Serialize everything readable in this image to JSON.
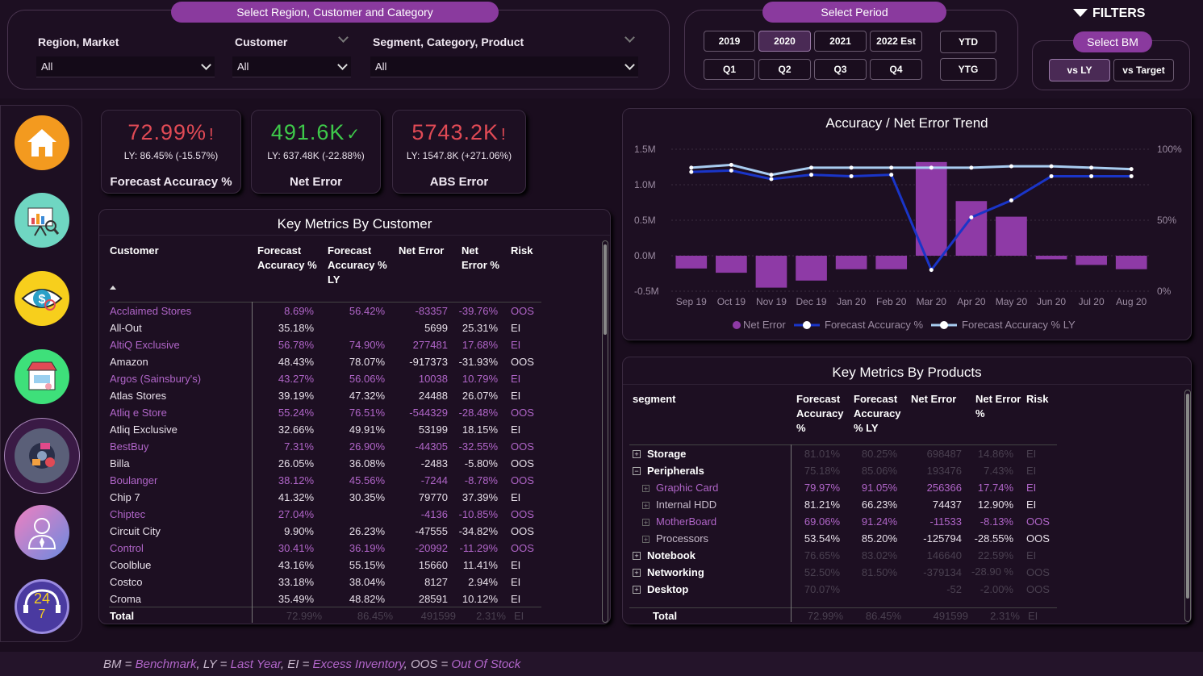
{
  "filters_panel": {
    "title": "Select Region, Customer and Category",
    "region_label": "Region, Market",
    "region_value": "All",
    "customer_label": "Customer",
    "customer_value": "All",
    "segment_label": "Segment, Category, Product",
    "segment_value": "All"
  },
  "period_panel": {
    "title": "Select Period",
    "years": [
      "2019",
      "2020",
      "2021",
      "2022 Est"
    ],
    "quarters": [
      "Q1",
      "Q2",
      "Q3",
      "Q4"
    ],
    "ytd": "YTD",
    "ytg": "YTG",
    "selected_year": "2020"
  },
  "bm_panel": {
    "filters_title": "FILTERS",
    "title": "Select BM",
    "options": [
      "vs LY",
      "vs Target"
    ],
    "selected": "vs LY"
  },
  "sidebar": {
    "items": [
      "home-icon",
      "presentation-chart-icon",
      "eye-dollar-icon",
      "store-icon",
      "forecast-disc-icon",
      "person-icon",
      "support-24-7-icon"
    ],
    "selected_index": 4
  },
  "kpis": [
    {
      "value": "72.99%",
      "flag": "!",
      "ly": "LY: 86.45% (-15.57%)",
      "title": "Forecast Accuracy %",
      "status": "bad"
    },
    {
      "value": "491.6K",
      "flag": "✓",
      "ly": "LY: 637.48K (-22.88%)",
      "title": "Net Error",
      "status": "good"
    },
    {
      "value": "5743.2K",
      "flag": "!",
      "ly": "LY: 1547.8K (+271.06%)",
      "title": "ABS Error",
      "status": "bad"
    }
  ],
  "customer_table": {
    "title": "Key Metrics By Customer",
    "headers": [
      "Customer",
      "Forecast Accuracy %",
      "Forecast Accuracy % LY",
      "Net Error",
      "Net Error %",
      "Risk"
    ],
    "rows": [
      [
        "Acclaimed Stores",
        "8.69%",
        "56.42%",
        "-83357",
        "-39.76%",
        "OOS"
      ],
      [
        "All-Out",
        "35.18%",
        "",
        "5699",
        "25.31%",
        "EI"
      ],
      [
        "AltiQ Exclusive",
        "56.78%",
        "74.90%",
        "277481",
        "17.68%",
        "EI"
      ],
      [
        "Amazon",
        "48.43%",
        "78.07%",
        "-917373",
        "-31.93%",
        "OOS"
      ],
      [
        "Argos (Sainsbury's)",
        "43.27%",
        "56.06%",
        "10038",
        "10.79%",
        "EI"
      ],
      [
        "Atlas Stores",
        "39.19%",
        "47.32%",
        "24488",
        "26.07%",
        "EI"
      ],
      [
        "Atliq e Store",
        "55.24%",
        "76.51%",
        "-544329",
        "-28.48%",
        "OOS"
      ],
      [
        "Atliq Exclusive",
        "32.66%",
        "49.91%",
        "53199",
        "18.15%",
        "EI"
      ],
      [
        "BestBuy",
        "7.31%",
        "26.90%",
        "-44305",
        "-32.55%",
        "OOS"
      ],
      [
        "Billa",
        "26.05%",
        "36.08%",
        "-2483",
        "-5.80%",
        "OOS"
      ],
      [
        "Boulanger",
        "38.12%",
        "45.56%",
        "-7244",
        "-8.78%",
        "OOS"
      ],
      [
        "Chip 7",
        "41.32%",
        "30.35%",
        "79770",
        "37.39%",
        "EI"
      ],
      [
        "Chiptec",
        "27.04%",
        "",
        "-4136",
        "-10.85%",
        "OOS"
      ],
      [
        "Circuit City",
        "9.90%",
        "26.23%",
        "-47555",
        "-34.82%",
        "OOS"
      ],
      [
        "Control",
        "30.41%",
        "36.19%",
        "-20992",
        "-11.29%",
        "OOS"
      ],
      [
        "Coolblue",
        "43.16%",
        "55.15%",
        "15660",
        "11.41%",
        "EI"
      ],
      [
        "Costco",
        "33.18%",
        "38.04%",
        "8127",
        "2.94%",
        "EI"
      ],
      [
        "Croma",
        "35.49%",
        "48.82%",
        "28591",
        "10.12%",
        "EI"
      ]
    ],
    "highlight_rows": [
      0,
      2,
      4,
      6,
      8,
      10,
      12,
      14
    ],
    "total": [
      "Total",
      "72.99%",
      "86.45%",
      "491599",
      "2.31%",
      "EI"
    ]
  },
  "trend_chart": {
    "title": "Accuracy / Net Error Trend",
    "y_left_ticks": [
      "1.5M",
      "1.0M",
      "0.5M",
      "0.0M",
      "-0.5M"
    ],
    "y_right_ticks": [
      "100%",
      "50%",
      "0%"
    ],
    "legend": [
      "Net Error",
      "Forecast Accuracy %",
      "Forecast Accuracy % LY"
    ]
  },
  "chart_data": {
    "type": "bar",
    "categories": [
      "Sep 19",
      "Oct 19",
      "Nov 19",
      "Dec 19",
      "Jan 20",
      "Feb 20",
      "Mar 20",
      "Apr 20",
      "May 20",
      "Jun 20",
      "Jul 20",
      "Aug 20"
    ],
    "series": [
      {
        "name": "Net Error",
        "type": "bar",
        "axis": "left",
        "values": [
          -180000,
          -240000,
          -450000,
          -350000,
          -190000,
          -190000,
          1320000,
          770000,
          550000,
          -50000,
          -130000,
          -190000
        ]
      },
      {
        "name": "Forecast Accuracy %",
        "type": "line",
        "axis": "right",
        "values": [
          84,
          85,
          79,
          82,
          81,
          82,
          15,
          52,
          64,
          81,
          81,
          81
        ]
      },
      {
        "name": "Forecast Accuracy % LY",
        "type": "line",
        "axis": "right",
        "values": [
          87,
          89,
          82,
          87,
          87,
          87,
          87,
          87,
          88,
          88,
          87,
          86
        ]
      }
    ],
    "ylim_left": [
      -500000,
      1500000
    ],
    "ylim_right": [
      0,
      100
    ],
    "title": "Accuracy / Net Error Trend",
    "legend_position": "bottom",
    "colors": {
      "bar": "#8e3aa6",
      "line": "#1a35c8",
      "line_ly": "#a8ccf0"
    }
  },
  "products_table": {
    "title": "Key Metrics By Products",
    "headers": [
      "segment",
      "Forecast Accuracy %",
      "Forecast Accuracy % LY",
      "Net Error",
      "Net Error %",
      "Risk"
    ],
    "rows": [
      {
        "level": 0,
        "expand": "+",
        "label": "Storage",
        "vals": [
          "81.01%",
          "80.25%",
          "698487",
          "14.86%",
          "EI"
        ],
        "dim": true
      },
      {
        "level": 0,
        "expand": "−",
        "label": "Peripherals",
        "vals": [
          "75.18%",
          "85.06%",
          "193476",
          "7.43%",
          "EI"
        ],
        "dim": true
      },
      {
        "level": 1,
        "expand": "+",
        "label": "Graphic Card",
        "vals": [
          "79.97%",
          "91.05%",
          "256366",
          "17.74%",
          "EI"
        ],
        "dim": false,
        "purple": true
      },
      {
        "level": 1,
        "expand": "+",
        "label": "Internal HDD",
        "vals": [
          "81.21%",
          "66.23%",
          "74437",
          "12.90%",
          "EI"
        ],
        "dim": false,
        "purple": false
      },
      {
        "level": 1,
        "expand": "+",
        "label": "MotherBoard",
        "vals": [
          "69.06%",
          "91.24%",
          "-11533",
          "-8.13%",
          "OOS"
        ],
        "dim": false,
        "purple": true
      },
      {
        "level": 1,
        "expand": "+",
        "label": "Processors",
        "vals": [
          "53.54%",
          "85.20%",
          "-125794",
          "-28.55%",
          "OOS"
        ],
        "dim": false,
        "purple": false
      },
      {
        "level": 0,
        "expand": "+",
        "label": "Notebook",
        "vals": [
          "76.65%",
          "83.02%",
          "146640",
          "22.59%",
          "EI"
        ],
        "dim": true
      },
      {
        "level": 0,
        "expand": "+",
        "label": "Networking",
        "vals": [
          "52.50%",
          "81.50%",
          "-379134",
          "-28.90 %",
          "OOS"
        ],
        "dim": true
      },
      {
        "level": 0,
        "expand": "+",
        "label": "Desktop",
        "vals": [
          "70.07%",
          "",
          "-52",
          "-2.00%",
          "OOS"
        ],
        "dim": true
      }
    ],
    "total": [
      "Total",
      "72.99%",
      "86.45%",
      "491599",
      "2.31%",
      "EI"
    ]
  },
  "footer": {
    "prefix": "BM = ",
    "parts": [
      "Benchmark",
      ", LY = ",
      "Last Year",
      ", EI = ",
      "Excess Inventory",
      ", OOS = ",
      "Out Of Stock"
    ]
  }
}
